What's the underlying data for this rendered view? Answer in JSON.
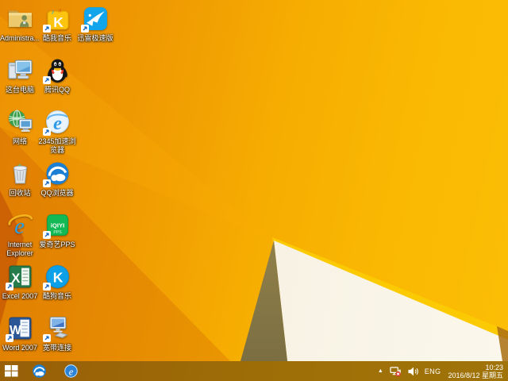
{
  "wallpaper": {
    "name": "windows-8-default-orange",
    "colors": {
      "orange_left": "#ee8f03",
      "gold_right": "#fbba04",
      "white_facet": "#f5efe0",
      "khaki_facet": "#a8934f",
      "taskbar_tint": "#54360c"
    }
  },
  "desktop": {
    "icons": [
      {
        "id": "user-folder",
        "label": "Administra...",
        "shortcut": false,
        "col": 0,
        "row": 0
      },
      {
        "id": "this-pc",
        "label": "这台电脑",
        "shortcut": false,
        "col": 0,
        "row": 1
      },
      {
        "id": "network",
        "label": "网络",
        "shortcut": false,
        "col": 0,
        "row": 2
      },
      {
        "id": "recycle-bin",
        "label": "回收站",
        "shortcut": false,
        "col": 0,
        "row": 3
      },
      {
        "id": "internet-explorer",
        "label": "Internet Explorer",
        "shortcut": false,
        "col": 0,
        "row": 4
      },
      {
        "id": "excel",
        "label": "Excel 2007",
        "shortcut": true,
        "col": 0,
        "row": 5
      },
      {
        "id": "word",
        "label": "Word 2007",
        "shortcut": true,
        "col": 0,
        "row": 6
      },
      {
        "id": "kuwo-music",
        "label": "酷我音乐",
        "shortcut": true,
        "col": 1,
        "row": 0
      },
      {
        "id": "tencent-qq",
        "label": "腾讯QQ",
        "shortcut": true,
        "col": 1,
        "row": 1
      },
      {
        "id": "browser-2345",
        "label": "2345加速浏览器",
        "shortcut": true,
        "col": 1,
        "row": 2
      },
      {
        "id": "qq-browser",
        "label": "QQ浏览器",
        "shortcut": true,
        "col": 1,
        "row": 3
      },
      {
        "id": "iqiyi-pps",
        "label": "爱奇艺PPS",
        "shortcut": true,
        "col": 1,
        "row": 4
      },
      {
        "id": "kugou-music",
        "label": "酷狗音乐",
        "shortcut": true,
        "col": 1,
        "row": 5
      },
      {
        "id": "broadband",
        "label": "宽带连接",
        "shortcut": true,
        "col": 1,
        "row": 6
      },
      {
        "id": "xunlei",
        "label": "迅雷极速版",
        "shortcut": true,
        "col": 2,
        "row": 0
      }
    ]
  },
  "taskbar": {
    "pinned": [
      {
        "id": "qq-browser-task"
      },
      {
        "id": "ie-task"
      }
    ],
    "tray": {
      "language": "ENG",
      "time": "10:23",
      "date": "2016/8/12 星期五"
    }
  }
}
